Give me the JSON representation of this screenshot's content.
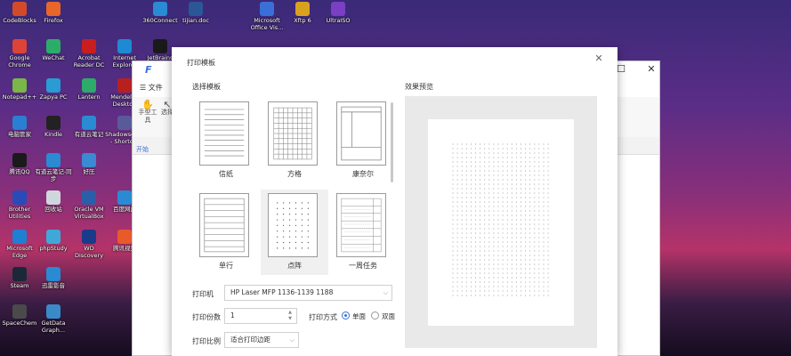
{
  "desktop": {
    "icons": [
      {
        "label": "CodeBlocks",
        "color": "#d34a2a"
      },
      {
        "label": "Firefox",
        "color": "#e8662a"
      },
      {
        "label": "360Connect",
        "color": "#2a8ad3"
      },
      {
        "label": "tijian.doc",
        "color": "#2b5797"
      },
      {
        "label": "Microsoft Office Vis...",
        "color": "#3b6fd8"
      },
      {
        "label": "Xftp 6",
        "color": "#d9a21e"
      },
      {
        "label": "UltraISO",
        "color": "#7a3fc2"
      },
      {
        "label": "Google Chrome",
        "color": "#db4437"
      },
      {
        "label": "WeChat",
        "color": "#2aae67"
      },
      {
        "label": "Acrobat Reader DC",
        "color": "#c81e1e"
      },
      {
        "label": "Internet Explorer",
        "color": "#1e8ad3"
      },
      {
        "label": "JetBrains",
        "color": "#1a1a1a"
      },
      {
        "label": "Notepad++",
        "color": "#7ab648"
      },
      {
        "label": "Zapya PC",
        "color": "#2a9bd3"
      },
      {
        "label": "Lantern",
        "color": "#2eaa6a"
      },
      {
        "label": "Mendeley Desktop",
        "color": "#b8201f"
      },
      {
        "label": "电脑管家",
        "color": "#2a7fd3"
      },
      {
        "label": "Kindle",
        "color": "#222222"
      },
      {
        "label": "有道云笔记",
        "color": "#2a8ad3"
      },
      {
        "label": "Shadowsocks - Shortcut",
        "color": "#5a5a9a"
      },
      {
        "label": "腾讯QQ",
        "color": "#1a1a1a"
      },
      {
        "label": "有道云笔记-同步",
        "color": "#2a8ad3"
      },
      {
        "label": "好压",
        "color": "#3b8ad3"
      },
      {
        "label": "Brother Utilities",
        "color": "#2a4ab8"
      },
      {
        "label": "回收站",
        "color": "#cfd6de"
      },
      {
        "label": "Oracle VM VirtualBox",
        "color": "#2b5ea8"
      },
      {
        "label": "百度网盘",
        "color": "#2a8ad3"
      },
      {
        "label": "Microsoft Edge",
        "color": "#1e7fd3"
      },
      {
        "label": "phpStudy",
        "color": "#3ea8d8"
      },
      {
        "label": "WD Discovery",
        "color": "#1a3a8a"
      },
      {
        "label": "腾讯视频",
        "color": "#e85a2a"
      },
      {
        "label": "Steam",
        "color": "#1b2838"
      },
      {
        "label": "迅雷影音",
        "color": "#2a8ad3"
      },
      {
        "label": "SpaceChem",
        "color": "#4a4a4a"
      },
      {
        "label": "GetData Graph...",
        "color": "#3a8ac8"
      }
    ]
  },
  "background_window": {
    "menu_file": "文件",
    "tools": [
      {
        "label": "手型工具",
        "icon": "hand-icon"
      },
      {
        "label": "选择",
        "icon": "cursor-icon"
      }
    ],
    "start_tab": "开始"
  },
  "dialog": {
    "title": "打印模板",
    "select_template_label": "选择模板",
    "preview_label": "效果预览",
    "templates": [
      {
        "name": "信纸",
        "pattern": "lines"
      },
      {
        "name": "方格",
        "pattern": "grid"
      },
      {
        "name": "康奈尔",
        "pattern": "cornell"
      },
      {
        "name": "单行",
        "pattern": "single-line"
      },
      {
        "name": "点阵",
        "pattern": "dots"
      },
      {
        "name": "一周任务",
        "pattern": "weekly"
      }
    ],
    "selected_template": "点阵",
    "printer_label": "打印机",
    "printer_value": "HP Laser MFP 1136-1139 1188",
    "copies_label": "打印份数",
    "copies_value": "1",
    "mode_label": "打印方式",
    "mode_options": [
      "单面",
      "双面"
    ],
    "mode_selected": "单面",
    "scale_label": "打印比例",
    "scale_value": "适合打印边距"
  },
  "colors": {
    "accent": "#3b6fd8",
    "preview_bg": "#e9e9e9"
  }
}
